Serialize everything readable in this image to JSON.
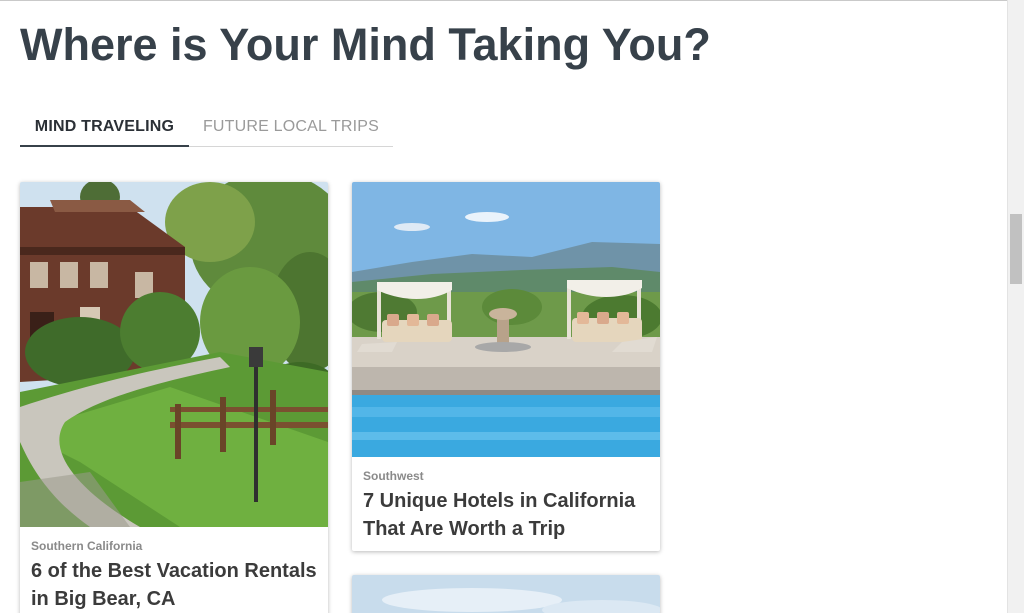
{
  "page": {
    "title": "Where is Your Mind Taking You?"
  },
  "tabs": [
    {
      "label": "MIND TRAVELING",
      "active": true
    },
    {
      "label": "FUTURE LOCAL TRIPS",
      "active": false
    }
  ],
  "cards": [
    {
      "category": "Southern California",
      "title": "6 of the Best Vacation Rentals in Big Bear, CA",
      "image": "vacation-rental-lodge-garden"
    },
    {
      "category": "Southwest",
      "title": "7 Unique Hotels in California That Are Worth a Trip",
      "image": "hotel-poolside-cabanas-mountains"
    },
    {
      "category": "",
      "title": "",
      "image": "sky-partial"
    }
  ],
  "colors": {
    "title": "#37414a",
    "tab_active": "#2b3036",
    "tab_inactive": "#9a9a9a",
    "category": "#8a8a8a",
    "card_title": "#3b3b3b"
  }
}
